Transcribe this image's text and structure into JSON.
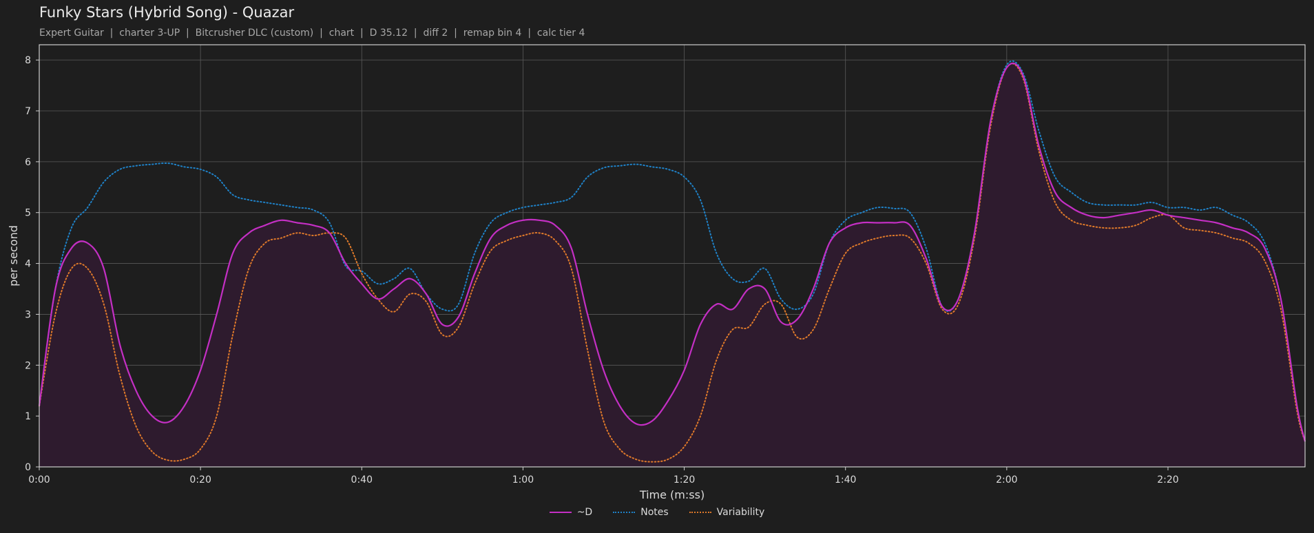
{
  "title": "Funky Stars (Hybrid Song) - Quazar",
  "subtitle": "Expert Guitar  |  charter 3-UP  |  Bitcrusher DLC (custom)  |  chart  |  D 35.12  |  diff 2  |  remap bin 4  |  calc tier 4",
  "colors": {
    "background": "#1e1e1e",
    "grid": "#5a5a5a",
    "axis": "#cfcfcf",
    "d": "#c42fc4",
    "notes": "#1f82c8",
    "variability": "#e07a2a",
    "fill": "#2e1b2e"
  },
  "chart_data": {
    "type": "line",
    "xlabel": "Time (m:ss)",
    "ylabel": "per second",
    "xlim": [
      0,
      157
    ],
    "ylim": [
      0,
      8.3
    ],
    "x_ticks": [
      0,
      20,
      40,
      60,
      80,
      100,
      120,
      140
    ],
    "x_tick_labels": [
      "0:00",
      "0:20",
      "0:40",
      "1:00",
      "1:20",
      "1:40",
      "2:00",
      "2:20"
    ],
    "y_ticks": [
      0,
      1,
      2,
      3,
      4,
      5,
      6,
      7,
      8
    ],
    "grid": true,
    "legend_position": "bottom-center",
    "series": [
      {
        "name": "~D",
        "style": "solid",
        "filled": true,
        "x": [
          0,
          2,
          4,
          6,
          8,
          10,
          12,
          14,
          16,
          18,
          20,
          22,
          24,
          26,
          28,
          30,
          32,
          34,
          36,
          38,
          40,
          42,
          44,
          46,
          48,
          50,
          52,
          54,
          56,
          58,
          60,
          62,
          64,
          66,
          68,
          70,
          72,
          74,
          76,
          78,
          80,
          82,
          84,
          86,
          88,
          90,
          92,
          94,
          96,
          98,
          100,
          102,
          104,
          106,
          108,
          110,
          112,
          114,
          116,
          118,
          120,
          122,
          124,
          126,
          128,
          130,
          132,
          134,
          136,
          138,
          140,
          142,
          144,
          146,
          148,
          150,
          152,
          154,
          156,
          157
        ],
        "values": [
          1.2,
          3.5,
          4.3,
          4.4,
          3.9,
          2.4,
          1.5,
          1.0,
          0.88,
          1.2,
          1.9,
          3.0,
          4.2,
          4.6,
          4.75,
          4.85,
          4.8,
          4.75,
          4.6,
          4.0,
          3.6,
          3.3,
          3.5,
          3.7,
          3.4,
          2.8,
          2.95,
          3.8,
          4.5,
          4.75,
          4.85,
          4.85,
          4.75,
          4.3,
          3.0,
          1.9,
          1.2,
          0.85,
          0.9,
          1.3,
          1.9,
          2.8,
          3.2,
          3.1,
          3.5,
          3.5,
          2.85,
          2.9,
          3.5,
          4.4,
          4.7,
          4.8,
          4.8,
          4.8,
          4.75,
          4.1,
          3.15,
          3.3,
          4.6,
          6.8,
          7.85,
          7.7,
          6.3,
          5.4,
          5.1,
          4.95,
          4.9,
          4.95,
          5.0,
          5.05,
          4.95,
          4.9,
          4.85,
          4.8,
          4.7,
          4.6,
          4.3,
          3.3,
          1.2,
          0.5
        ]
      },
      {
        "name": "Notes",
        "style": "dotted",
        "filled": false,
        "x": [
          0,
          2,
          4,
          6,
          8,
          10,
          12,
          14,
          16,
          18,
          20,
          22,
          24,
          26,
          28,
          30,
          32,
          34,
          36,
          38,
          40,
          42,
          44,
          46,
          48,
          50,
          52,
          54,
          56,
          58,
          60,
          62,
          64,
          66,
          68,
          70,
          72,
          74,
          76,
          78,
          80,
          82,
          84,
          86,
          88,
          90,
          92,
          94,
          96,
          98,
          100,
          102,
          104,
          106,
          108,
          110,
          112,
          114,
          116,
          118,
          120,
          122,
          124,
          126,
          128,
          130,
          132,
          134,
          136,
          138,
          140,
          142,
          144,
          146,
          148,
          150,
          152,
          154,
          156,
          157
        ],
        "values": [
          1.2,
          3.5,
          4.7,
          5.1,
          5.6,
          5.85,
          5.92,
          5.95,
          5.97,
          5.9,
          5.85,
          5.7,
          5.35,
          5.25,
          5.2,
          5.15,
          5.1,
          5.05,
          4.8,
          3.95,
          3.85,
          3.6,
          3.7,
          3.9,
          3.4,
          3.1,
          3.2,
          4.2,
          4.8,
          5.0,
          5.1,
          5.15,
          5.2,
          5.3,
          5.7,
          5.88,
          5.92,
          5.95,
          5.9,
          5.85,
          5.7,
          5.25,
          4.2,
          3.7,
          3.65,
          3.9,
          3.3,
          3.1,
          3.4,
          4.4,
          4.85,
          5.0,
          5.1,
          5.08,
          5.0,
          4.3,
          3.15,
          3.3,
          4.6,
          6.8,
          7.9,
          7.75,
          6.6,
          5.7,
          5.4,
          5.2,
          5.15,
          5.15,
          5.15,
          5.2,
          5.1,
          5.1,
          5.05,
          5.1,
          4.95,
          4.8,
          4.4,
          3.3,
          1.2,
          0.5
        ]
      },
      {
        "name": "Variability",
        "style": "dotted",
        "filled": false,
        "x": [
          0,
          2,
          4,
          6,
          8,
          10,
          12,
          14,
          16,
          18,
          20,
          22,
          24,
          26,
          28,
          30,
          32,
          34,
          36,
          38,
          40,
          42,
          44,
          46,
          48,
          50,
          52,
          54,
          56,
          58,
          60,
          62,
          64,
          66,
          68,
          70,
          72,
          74,
          76,
          78,
          80,
          82,
          84,
          86,
          88,
          90,
          92,
          94,
          96,
          98,
          100,
          102,
          104,
          106,
          108,
          110,
          112,
          114,
          116,
          118,
          120,
          122,
          124,
          126,
          128,
          130,
          132,
          134,
          136,
          138,
          140,
          142,
          144,
          146,
          148,
          150,
          152,
          154,
          156,
          157
        ],
        "values": [
          1.2,
          3.0,
          3.9,
          3.9,
          3.2,
          1.8,
          0.8,
          0.3,
          0.13,
          0.15,
          0.35,
          1.0,
          2.6,
          3.9,
          4.4,
          4.5,
          4.6,
          4.55,
          4.6,
          4.5,
          3.8,
          3.3,
          3.05,
          3.4,
          3.25,
          2.6,
          2.75,
          3.6,
          4.25,
          4.45,
          4.55,
          4.6,
          4.45,
          3.9,
          2.3,
          0.9,
          0.35,
          0.15,
          0.1,
          0.15,
          0.4,
          1.0,
          2.1,
          2.7,
          2.75,
          3.2,
          3.2,
          2.55,
          2.7,
          3.5,
          4.2,
          4.4,
          4.5,
          4.55,
          4.5,
          4.0,
          3.1,
          3.2,
          4.5,
          6.7,
          7.85,
          7.65,
          6.2,
          5.2,
          4.85,
          4.75,
          4.7,
          4.7,
          4.75,
          4.9,
          4.95,
          4.7,
          4.65,
          4.6,
          4.5,
          4.4,
          4.05,
          3.1,
          1.1,
          0.5
        ]
      }
    ]
  }
}
